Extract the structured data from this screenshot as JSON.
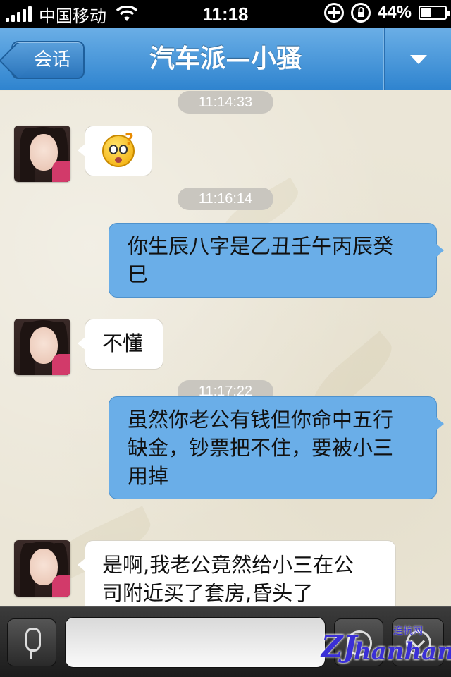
{
  "status_bar": {
    "carrier": "中国移动",
    "time": "11:18",
    "battery_percent": "44%",
    "battery_level": 0.44,
    "signal_icon": "signal-bars-icon",
    "wifi_icon": "wifi-icon"
  },
  "nav": {
    "back_label": "会话",
    "title": "汽车派—小骚",
    "menu_icon": "chevron-down-icon"
  },
  "messages": [
    {
      "type": "timestamp",
      "text": "11:14:33"
    },
    {
      "type": "incoming",
      "content": "emoji",
      "emoji_icon": "confused-face-icon"
    },
    {
      "type": "timestamp",
      "text": "11:16:14"
    },
    {
      "type": "outgoing",
      "lines": [
        "你生辰八字是乙丑壬午丙辰癸",
        "巳"
      ]
    },
    {
      "type": "incoming",
      "lines": [
        "不懂"
      ]
    },
    {
      "type": "timestamp",
      "text": "11:17:22"
    },
    {
      "type": "outgoing",
      "lines": [
        "虽然你老公有钱但你命中五行",
        "缺金，钞票把不住，要被小三",
        "用掉"
      ]
    },
    {
      "type": "incoming",
      "lines": [
        "是啊,我老公竟然给小三在公",
        "司附近买了套房,昏头了"
      ]
    }
  ],
  "input_bar": {
    "voice_icon": "microphone-icon",
    "input_value": "",
    "emoji_icon": "smiley-icon",
    "more_icon": "expand-icon"
  },
  "watermark": {
    "brand": "ZJ",
    "name": "hanhang",
    "cn": "连杭网"
  },
  "colors": {
    "nav_blue": "#2f84cf",
    "outgoing_bubble": "#6aaee8",
    "incoming_bubble": "#ffffff",
    "timestamp_bg": "#c9c6bf"
  }
}
